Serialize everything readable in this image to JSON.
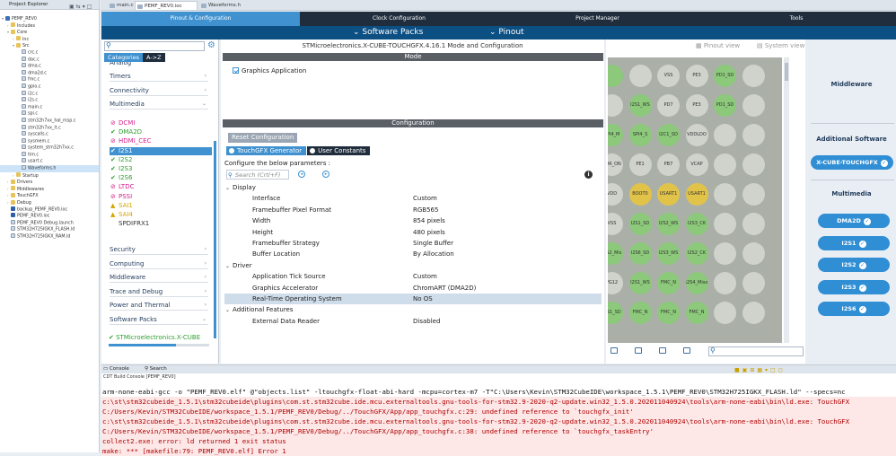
{
  "explorer": {
    "title": "Project Explorer",
    "items": [
      {
        "label": "PEMF_REV0",
        "indent": 0,
        "icon": "proj",
        "twisty": "▾"
      },
      {
        "label": "Includes",
        "indent": 1,
        "icon": "folder",
        "twisty": "›"
      },
      {
        "label": "Core",
        "indent": 1,
        "icon": "folder",
        "twisty": "▾"
      },
      {
        "label": "Inc",
        "indent": 2,
        "icon": "folder",
        "twisty": "›"
      },
      {
        "label": "Src",
        "indent": 2,
        "icon": "folder",
        "twisty": "▾"
      },
      {
        "label": "crc.c",
        "indent": 3,
        "icon": "file"
      },
      {
        "label": "dac.c",
        "indent": 3,
        "icon": "file"
      },
      {
        "label": "dma.c",
        "indent": 3,
        "icon": "file"
      },
      {
        "label": "dma2d.c",
        "indent": 3,
        "icon": "file"
      },
      {
        "label": "fmc.c",
        "indent": 3,
        "icon": "file"
      },
      {
        "label": "gpio.c",
        "indent": 3,
        "icon": "file"
      },
      {
        "label": "i2c.c",
        "indent": 3,
        "icon": "file"
      },
      {
        "label": "i2s.c",
        "indent": 3,
        "icon": "file"
      },
      {
        "label": "main.c",
        "indent": 3,
        "icon": "file"
      },
      {
        "label": "spi.c",
        "indent": 3,
        "icon": "file"
      },
      {
        "label": "stm32h7xx_hal_msp.c",
        "indent": 3,
        "icon": "file"
      },
      {
        "label": "stm32h7xx_it.c",
        "indent": 3,
        "icon": "file"
      },
      {
        "label": "syscalls.c",
        "indent": 3,
        "icon": "file"
      },
      {
        "label": "sysmem.c",
        "indent": 3,
        "icon": "file"
      },
      {
        "label": "system_stm32h7xx.c",
        "indent": 3,
        "icon": "file"
      },
      {
        "label": "tim.c",
        "indent": 3,
        "icon": "file"
      },
      {
        "label": "usart.c",
        "indent": 3,
        "icon": "file"
      },
      {
        "label": "Waveforms.h",
        "indent": 3,
        "icon": "file",
        "selected": true
      },
      {
        "label": "Startup",
        "indent": 2,
        "icon": "folder",
        "twisty": "›"
      },
      {
        "label": "Drivers",
        "indent": 1,
        "icon": "folder",
        "twisty": "›"
      },
      {
        "label": "Middlewares",
        "indent": 1,
        "icon": "folder",
        "twisty": "›"
      },
      {
        "label": "TouchGFX",
        "indent": 1,
        "icon": "folder",
        "twisty": "›"
      },
      {
        "label": "Debug",
        "indent": 1,
        "icon": "folder",
        "twisty": "›"
      },
      {
        "label": "backup_PEMF_REV0.ioc",
        "indent": 1,
        "icon": "ioc"
      },
      {
        "label": "PEMF_REV0.ioc",
        "indent": 1,
        "icon": "ioc"
      },
      {
        "label": "PEMF_REV0 Debug.launch",
        "indent": 1,
        "icon": "file"
      },
      {
        "label": "STM32H725IGKX_FLASH.ld",
        "indent": 1,
        "icon": "file"
      },
      {
        "label": "STM32H725IGKX_RAM.ld",
        "indent": 1,
        "icon": "file"
      }
    ]
  },
  "editor_tabs": [
    {
      "label": "main.c",
      "active": false
    },
    {
      "label": "PEMF_REV0.ioc",
      "active": true
    },
    {
      "label": "Waveforms.h",
      "active": false
    }
  ],
  "nav": {
    "tabs": [
      "Pinout & Configuration",
      "Clock Configuration",
      "Project Manager",
      "Tools"
    ],
    "software_packs": "Software Packs",
    "pinout": "Pinout"
  },
  "categories": {
    "tab_categories": "Categories",
    "tab_az": "A->Z",
    "top_partial": "Analog",
    "groups_top": [
      "Timers",
      "Connectivity",
      "Multimedia"
    ],
    "peripherals": [
      {
        "label": "DCMI",
        "status": "disabled"
      },
      {
        "label": "DMA2D",
        "status": "enabled"
      },
      {
        "label": "HDMI_CEC",
        "status": "disabled"
      },
      {
        "label": "I2S1",
        "status": "enabled",
        "selected": true
      },
      {
        "label": "I2S2",
        "status": "enabled"
      },
      {
        "label": "I2S3",
        "status": "enabled"
      },
      {
        "label": "I2S6",
        "status": "enabled"
      },
      {
        "label": "LTDC",
        "status": "disabled"
      },
      {
        "label": "PSSI",
        "status": "disabled"
      },
      {
        "label": "SAI1",
        "status": "warning"
      },
      {
        "label": "SAI4",
        "status": "warning"
      },
      {
        "label": "SPDIFRX1",
        "status": "none"
      }
    ],
    "groups_bottom": [
      "Security",
      "Computing",
      "Middleware",
      "Trace and Debug",
      "Power and Thermal",
      "Software Packs"
    ],
    "pack": "STMicroelectronics.X-CUBE"
  },
  "center": {
    "title": "STMicroelectronics.X-CUBE-TOUCHGFX.4.16.1 Mode and Configuration",
    "mode_band": "Mode",
    "graphics_app": "Graphics Application",
    "config_band": "Configuration",
    "reset": "Reset Configuration",
    "tab_generator": "TouchGFX Generator",
    "tab_constants": "User Constants",
    "configure_text": "Configure the below parameters :",
    "search_placeholder": "Search (Crtl+F)",
    "params": [
      {
        "type": "group",
        "label": "Display"
      },
      {
        "type": "row",
        "k": "Interface",
        "v": "Custom"
      },
      {
        "type": "row",
        "k": "Framebuffer Pixel Format",
        "v": "RGB565"
      },
      {
        "type": "row",
        "k": "Width",
        "v": "854 pixels"
      },
      {
        "type": "row",
        "k": "Height",
        "v": "480 pixels"
      },
      {
        "type": "row",
        "k": "Framebuffer Strategy",
        "v": "Single Buffer"
      },
      {
        "type": "row",
        "k": "Buffer Location",
        "v": "By Allocation"
      },
      {
        "type": "group",
        "label": "Driver"
      },
      {
        "type": "row",
        "k": "Application Tick Source",
        "v": "Custom"
      },
      {
        "type": "row",
        "k": "Graphics Accelerator",
        "v": "ChromART (DMA2D)"
      },
      {
        "type": "row",
        "k": "Real-Time Operating System",
        "v": "No OS",
        "highlight": true
      },
      {
        "type": "group",
        "label": "Additional Features"
      },
      {
        "type": "row",
        "k": "External Data Reader",
        "v": "Disabled"
      }
    ]
  },
  "pinout": {
    "pinout_view": "Pinout view",
    "system_view": "System view",
    "pins": [
      {
        "l": "",
        "c": "g"
      },
      {
        "l": "",
        "c": "n"
      },
      {
        "l": "VSS",
        "c": "n"
      },
      {
        "l": "PE3",
        "c": "n"
      },
      {
        "l": "PD1_SD",
        "c": "g"
      },
      {
        "l": "",
        "c": "n"
      },
      {
        "l": "",
        "c": "n"
      },
      {
        "l": "I2S1_WS",
        "c": "g"
      },
      {
        "l": "PD7",
        "c": "n"
      },
      {
        "l": "PE3",
        "c": "n"
      },
      {
        "l": "PD1_SD",
        "c": "g"
      },
      {
        "l": "",
        "c": "n"
      },
      {
        "l": "SPI4_M",
        "c": "g"
      },
      {
        "l": "SPI4_S",
        "c": "g"
      },
      {
        "l": "I2C1_SD",
        "c": "g"
      },
      {
        "l": "VDDLDO",
        "c": "n"
      },
      {
        "l": "",
        "c": "n"
      },
      {
        "l": "",
        "c": "n"
      },
      {
        "l": "PDR_ON",
        "c": "n"
      },
      {
        "l": "PE1",
        "c": "n"
      },
      {
        "l": "PB7",
        "c": "n"
      },
      {
        "l": "VCAP",
        "c": "n"
      },
      {
        "l": "",
        "c": "n"
      },
      {
        "l": "",
        "c": "n"
      },
      {
        "l": "VDD",
        "c": "n"
      },
      {
        "l": "BOOT0",
        "c": "y"
      },
      {
        "l": "USART1",
        "c": "y"
      },
      {
        "l": "USART1",
        "c": "y"
      },
      {
        "l": "",
        "c": "n"
      },
      {
        "l": "",
        "c": "n"
      },
      {
        "l": "VSS",
        "c": "n"
      },
      {
        "l": "I2S1_SD",
        "c": "g"
      },
      {
        "l": "I2S2_WS",
        "c": "g"
      },
      {
        "l": "I2S3_CK",
        "c": "g"
      },
      {
        "l": "",
        "c": "n"
      },
      {
        "l": "",
        "c": "n"
      },
      {
        "l": "I2S2_Mis",
        "c": "g"
      },
      {
        "l": "I2S6_SD",
        "c": "g"
      },
      {
        "l": "I2S3_WS",
        "c": "g"
      },
      {
        "l": "I2S2_CK",
        "c": "g"
      },
      {
        "l": "",
        "c": "n"
      },
      {
        "l": "",
        "c": "n"
      },
      {
        "l": "PG12",
        "c": "n"
      },
      {
        "l": "I2S1_WS",
        "c": "g"
      },
      {
        "l": "FMC_N",
        "c": "g"
      },
      {
        "l": "I2S4_Miso",
        "c": "g"
      },
      {
        "l": "",
        "c": "n"
      },
      {
        "l": "",
        "c": "n"
      },
      {
        "l": "I2S1_SD",
        "c": "g"
      },
      {
        "l": "FMC_N",
        "c": "g"
      },
      {
        "l": "FMC_N",
        "c": "g"
      },
      {
        "l": "FMC_N",
        "c": "g"
      },
      {
        "l": "",
        "c": "n"
      },
      {
        "l": "",
        "c": "n"
      }
    ]
  },
  "software": {
    "middleware": "Middleware",
    "additional": "Additional Software",
    "xcube": "X-CUBE-TOUCHGFX",
    "multimedia": "Multimedia",
    "buttons": [
      "DMA2D",
      "I2S1",
      "I2S2",
      "I2S3",
      "I2S6"
    ]
  },
  "console": {
    "tab_console": "Console",
    "tab_search": "Search",
    "subtitle": "CDT Build Console [PEMF_REV0]",
    "lines": [
      {
        "t": "arm-none-eabi-gcc -o \"PEMF_REV0.elf\" @\"objects.list\"  -ltouchgfx-float-abi-hard -mcpu=cortex-m7 -T\"C:\\Users\\Kevin\\STM32CubeIDE\\workspace_1.5.1\\PEMF_REV0\\STM32H725IGKX_FLASH.ld\" --specs=nc",
        "e": false
      },
      {
        "t": "c:\\st\\stm32cubeide_1.5.1\\stm32cubeide\\plugins\\com.st.stm32cube.ide.mcu.externaltools.gnu-tools-for-stm32.9-2020-q2-update.win32_1.5.0.202011040924\\tools\\arm-none-eabi\\bin\\ld.exe: TouchGFX",
        "e": true
      },
      {
        "t": "C:/Users/Kevin/STM32CubeIDE/workspace_1.5.1/PEMF_REV0/Debug/../TouchGFX/App/app_touchgfx.c:29: undefined reference to `touchgfx_init'",
        "e": true
      },
      {
        "t": "c:\\st\\stm32cubeide_1.5.1\\stm32cubeide\\plugins\\com.st.stm32cube.ide.mcu.externaltools.gnu-tools-for-stm32.9-2020-q2-update.win32_1.5.0.202011040924\\tools\\arm-none-eabi\\bin\\ld.exe: TouchGFX",
        "e": true
      },
      {
        "t": "C:/Users/Kevin/STM32CubeIDE/workspace_1.5.1/PEMF_REV0/Debug/../TouchGFX/App/app_touchgfx.c:38: undefined reference to `touchgfx_taskEntry'",
        "e": true
      },
      {
        "t": "collect2.exe: error: ld returned 1 exit status",
        "e": true
      },
      {
        "t": "make: *** [makefile:79: PEMF_REV0.elf] Error 1",
        "e": true
      }
    ]
  }
}
